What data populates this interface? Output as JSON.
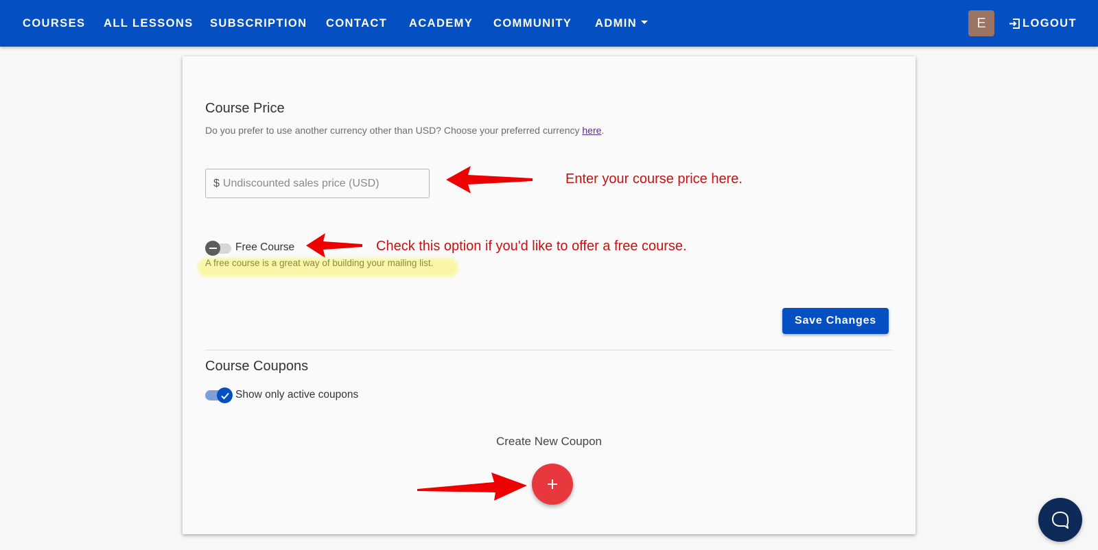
{
  "nav": {
    "items": [
      {
        "label": "COURSES"
      },
      {
        "label": "ALL LESSONS"
      },
      {
        "label": "SUBSCRIPTION"
      },
      {
        "label": "CONTACT"
      },
      {
        "label": "ACADEMY"
      },
      {
        "label": "COMMUNITY"
      },
      {
        "label": "ADMIN"
      }
    ],
    "avatar_initial": "E",
    "logout_label": "LOGOUT"
  },
  "price_section": {
    "title": "Course Price",
    "currency_note": "Do you prefer to use another currency other than USD? Choose your preferred currency ",
    "currency_link": "here",
    "currency_note_end": ".",
    "price_prefix": "$",
    "price_placeholder": "Undiscounted sales price (USD)",
    "price_value": "",
    "free_course_label": "Free Course",
    "free_course_enabled": false,
    "free_course_hint": "A free course is a great way of building your mailing list.",
    "save_label": "Save Changes"
  },
  "coupons_section": {
    "title": "Course Coupons",
    "active_only_label": "Show only active coupons",
    "active_only_enabled": true,
    "create_label": "Create New Coupon",
    "create_icon": "plus-icon"
  },
  "annotations": {
    "price_hint": "Enter your course price here.",
    "free_hint": "Check this option if you'd like to offer a free course."
  },
  "colors": {
    "brand_blue": "#0450c2",
    "fab_red": "#e8383e",
    "annotation_red": "#c81010",
    "chat_navy": "#0d2a58"
  }
}
